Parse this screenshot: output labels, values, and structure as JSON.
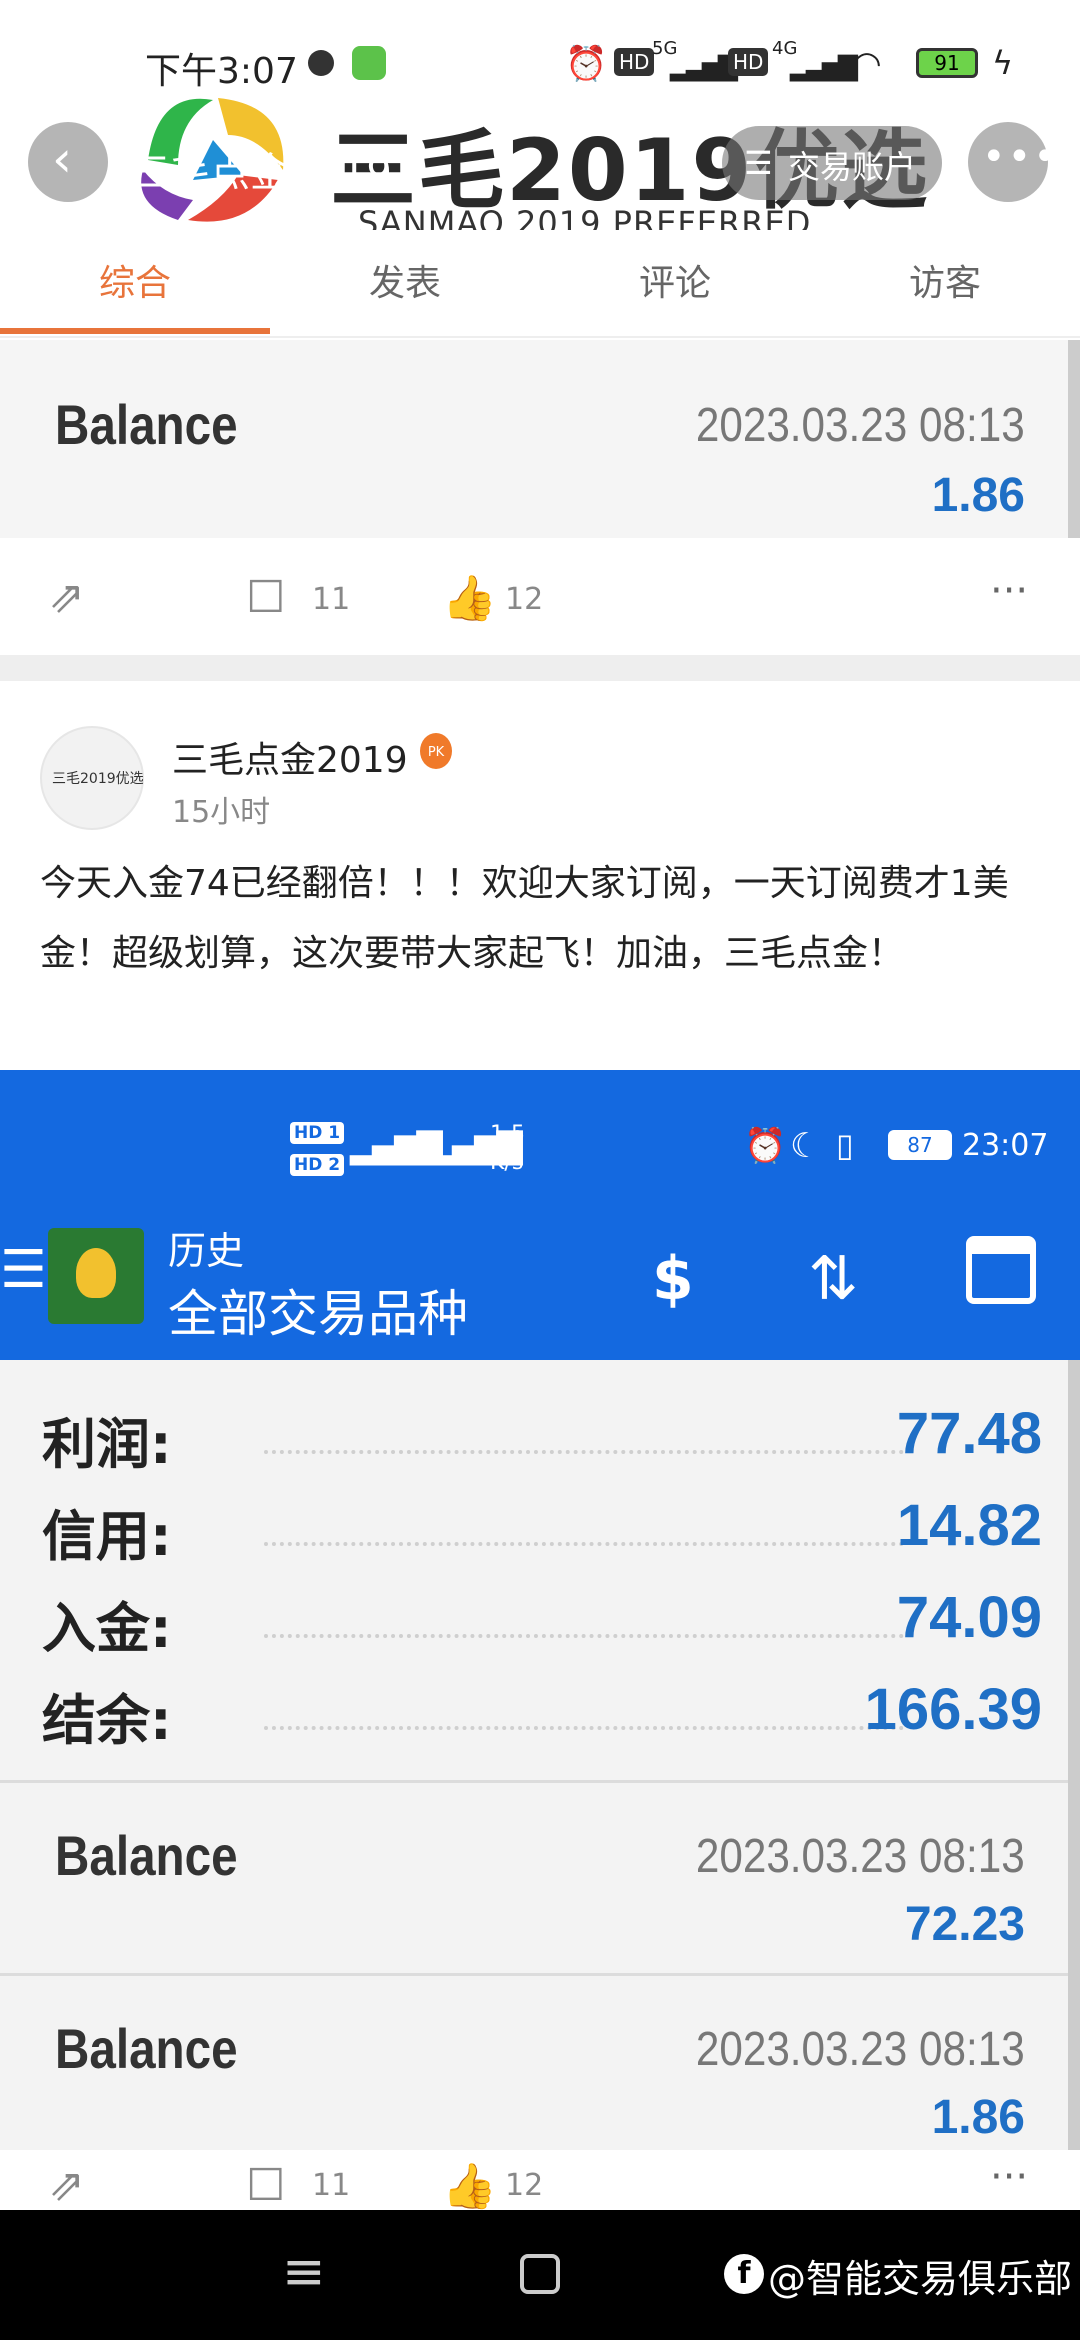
{
  "status_bar": {
    "time": "下午3:07",
    "battery": "91",
    "net1": "5G",
    "net2": "4G",
    "hd": "HD"
  },
  "header": {
    "banner_title": "三毛2019优选",
    "banner_subtitle": "SANMAO 2019 PREFERRED",
    "page_title": "三毛点金2019",
    "account_button": "交易账户",
    "more_icon": "more-horizontal-icon",
    "back_icon": "chevron-left-icon"
  },
  "tabs": [
    {
      "label": "综合",
      "active": true
    },
    {
      "label": "发表",
      "active": false
    },
    {
      "label": "评论",
      "active": false
    },
    {
      "label": "访客",
      "active": false
    }
  ],
  "prev_post": {
    "balance": {
      "label": "Balance",
      "datetime": "2023.03.23 08:13",
      "amount": "1.86"
    },
    "comments": "11",
    "likes": "12"
  },
  "post": {
    "author": "三毛点金2019",
    "badge": "PK",
    "time_ago": "15小时",
    "avatar_text": "三毛2019优选",
    "text": "今天入金74已经翻倍！！！欢迎大家订阅，一天订阅费才1美金！超级划算，这次要带大家起飞！加油，三毛点金！"
  },
  "screenshot": {
    "status": {
      "sim1": "HD 1",
      "sim2": "HD 2",
      "speed_value": "1.5",
      "speed_unit": "K/s",
      "battery": "87",
      "time": "23:07"
    },
    "toolbar": {
      "title": "历史",
      "subtitle": "全部交易品种"
    },
    "summary": [
      {
        "label": "利润:",
        "value": "77.48"
      },
      {
        "label": "信用:",
        "value": "14.82"
      },
      {
        "label": "入金:",
        "value": "74.09"
      },
      {
        "label": "结余:",
        "value": "166.39"
      }
    ],
    "entries": [
      {
        "label": "Balance",
        "datetime": "2023.03.23 08:13",
        "amount": "72.23"
      },
      {
        "label": "Balance",
        "datetime": "2023.03.23 08:13",
        "amount": "1.86"
      }
    ]
  },
  "post_actions": {
    "comments": "11",
    "likes": "12"
  },
  "watermark": "@智能交易俱乐部",
  "colors": {
    "accent": "#e8743b",
    "mt5_blue": "#1469e0",
    "value_blue": "#1f6fc5"
  }
}
